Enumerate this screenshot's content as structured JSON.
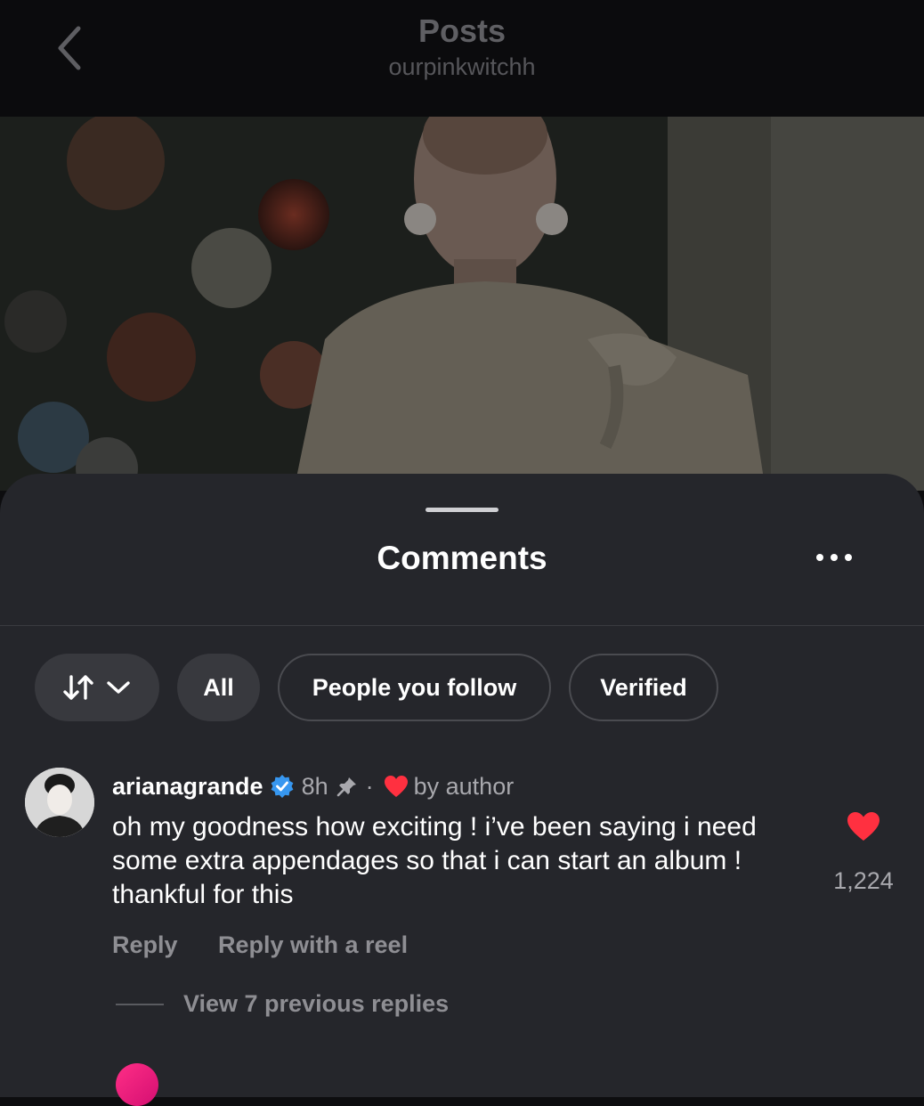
{
  "header": {
    "title": "Posts",
    "subtitle": "ourpinkwitchh"
  },
  "comments_sheet": {
    "title": "Comments",
    "filters": {
      "all_label": "All",
      "following_label": "People you follow",
      "verified_label": "Verified"
    },
    "comment": {
      "username": "arianagrande",
      "time": "8h",
      "separator": "·",
      "liked_by": "by author",
      "text": "oh my goodness how exciting ! i’ve been saying i need some extra appendages so that i can start an album ! thankful for this",
      "like_count": "1,224",
      "reply_label": "Reply",
      "reply_reel_label": "Reply with a reel",
      "view_replies_label": "View 7 previous replies"
    }
  },
  "colors": {
    "sheet_background": "#25262b",
    "verified_badge": "#3797f0",
    "like_heart": "#ff3040"
  },
  "icons": [
    "back-icon",
    "more-icon",
    "sort-icon",
    "chevron-down-icon",
    "verified-badge-icon",
    "pin-icon",
    "heart-icon"
  ]
}
